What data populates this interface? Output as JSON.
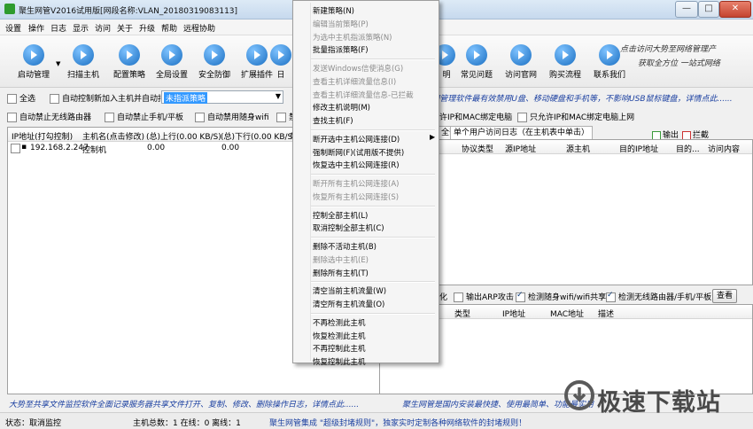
{
  "window": {
    "title": "聚生网管V2016试用版[网段名称:VLAN_20180319083113]",
    "min": "—",
    "max": "□",
    "close": "✕"
  },
  "menubar": [
    "设置",
    "操作",
    "日志",
    "显示",
    "访问",
    "关于",
    "升级",
    "帮助",
    "远程协助"
  ],
  "toolbar": {
    "left": [
      "启动管理",
      "扫描主机",
      "配置策略",
      "全局设置",
      "安全防御",
      "扩展插件",
      "日"
    ],
    "right": [
      "明",
      "常见问题",
      "访问官网",
      "购买流程",
      "联系我们"
    ],
    "slogan_line1": "点击访问大势至网络管理产",
    "slogan_line2": "获取全方位  一站式网络"
  },
  "options": {
    "select_all": "全选",
    "auto_control": "自动控制新加入主机并自动指派",
    "policy_value": "未指派策略",
    "notice": "P网管理软件最有效禁用U盘、移动硬盘和手机等，不影响USB鼠标键盘，详情点此......",
    "block_router": "自动禁止无线路由器",
    "block_phone": "自动禁止手机/平板",
    "block_wifi": "自动禁用随身wifi",
    "block_more": "禁",
    "bind_ip_mac": "许IP和MAC绑定电脑",
    "only_bind": "只允许IP和MAC绑定电脑上网"
  },
  "host_table": {
    "headers": [
      "IP地址(打勾控制)",
      "主机名(点击修改)",
      "(总)上行(0.00 KB/S)",
      "(总)下行(0.00 KB/S)",
      "带"
    ],
    "rows": [
      {
        "ip": "192.168.2.247",
        "name": "控制机",
        "up": "0.00",
        "down": "0.00"
      }
    ]
  },
  "log_panel": {
    "tab_left": "全部",
    "tab_right": "单个用户访问日志（在主机表中单击）",
    "legend_out": "输出",
    "legend_block": "拦截",
    "headers": [
      "协议类型",
      "源IP地址",
      "源主机",
      "目的IP地址",
      "目的...",
      "访问内容"
    ]
  },
  "alert_panel": {
    "opts": [
      "化",
      "输出ARP攻击",
      "检测随身wifi/wifi共享",
      "检测无线路由器/手机/平板"
    ],
    "view_button": "查看",
    "headers": [
      "类型",
      "IP地址",
      "MAC地址",
      "描述"
    ]
  },
  "bottom_info": {
    "left": "大势至共享文件监控软件全面记录服务器共享文件打开、复制、修改、删除操作日志，详情点此......",
    "right": "聚生网管是国内安装最快捷、使用最简单、功能最实用"
  },
  "statusbar": {
    "state": "状态：取消监控",
    "hosts": "主机总数：1  在线：0  离线：1",
    "message": "聚生网管集成 \"超级封堵规则\"，独家实时定制各种网络软件的封堵规则！"
  },
  "watermark": "极速下载站",
  "context_menu": {
    "groups": [
      [
        {
          "label": "新建策略(N)",
          "enabled": true
        },
        {
          "label": "编辑当前策略(P)",
          "enabled": false
        },
        {
          "label": "为选中主机指派策略(N)",
          "enabled": false
        },
        {
          "label": "批量指派策略(F)",
          "enabled": true
        }
      ],
      [
        {
          "label": "发送Windows信使消息(G)",
          "enabled": false
        },
        {
          "label": "查看主机详细流量信息(I)",
          "enabled": false
        },
        {
          "label": "查看主机详细流量信息-已拦截",
          "enabled": false
        },
        {
          "label": "修改主机说明(M)",
          "enabled": true
        },
        {
          "label": "查找主机(F)",
          "enabled": true
        }
      ],
      [
        {
          "label": "断开选中主机公网连接(D)",
          "enabled": true,
          "submenu": true
        },
        {
          "label": "强制断网(F)(试用版不提供)",
          "enabled": true
        },
        {
          "label": "恢复选中主机公网连接(R)",
          "enabled": true
        }
      ],
      [
        {
          "label": "断开所有主机公网连接(A)",
          "enabled": false
        },
        {
          "label": "恢复所有主机公网连接(S)",
          "enabled": false
        }
      ],
      [
        {
          "label": "控制全部主机(L)",
          "enabled": true
        },
        {
          "label": "取消控制全部主机(C)",
          "enabled": true
        }
      ],
      [
        {
          "label": "删除不活动主机(B)",
          "enabled": true
        },
        {
          "label": "删除选中主机(E)",
          "enabled": false
        },
        {
          "label": "删除所有主机(T)",
          "enabled": true
        }
      ],
      [
        {
          "label": "清空当前主机流量(W)",
          "enabled": true
        },
        {
          "label": "清空所有主机流量(O)",
          "enabled": true
        }
      ],
      [
        {
          "label": "不再检测此主机",
          "enabled": true
        },
        {
          "label": "恢复检测此主机",
          "enabled": true
        },
        {
          "label": "不再控制此主机",
          "enabled": true
        },
        {
          "label": "恢复控制此主机",
          "enabled": true
        }
      ]
    ]
  }
}
